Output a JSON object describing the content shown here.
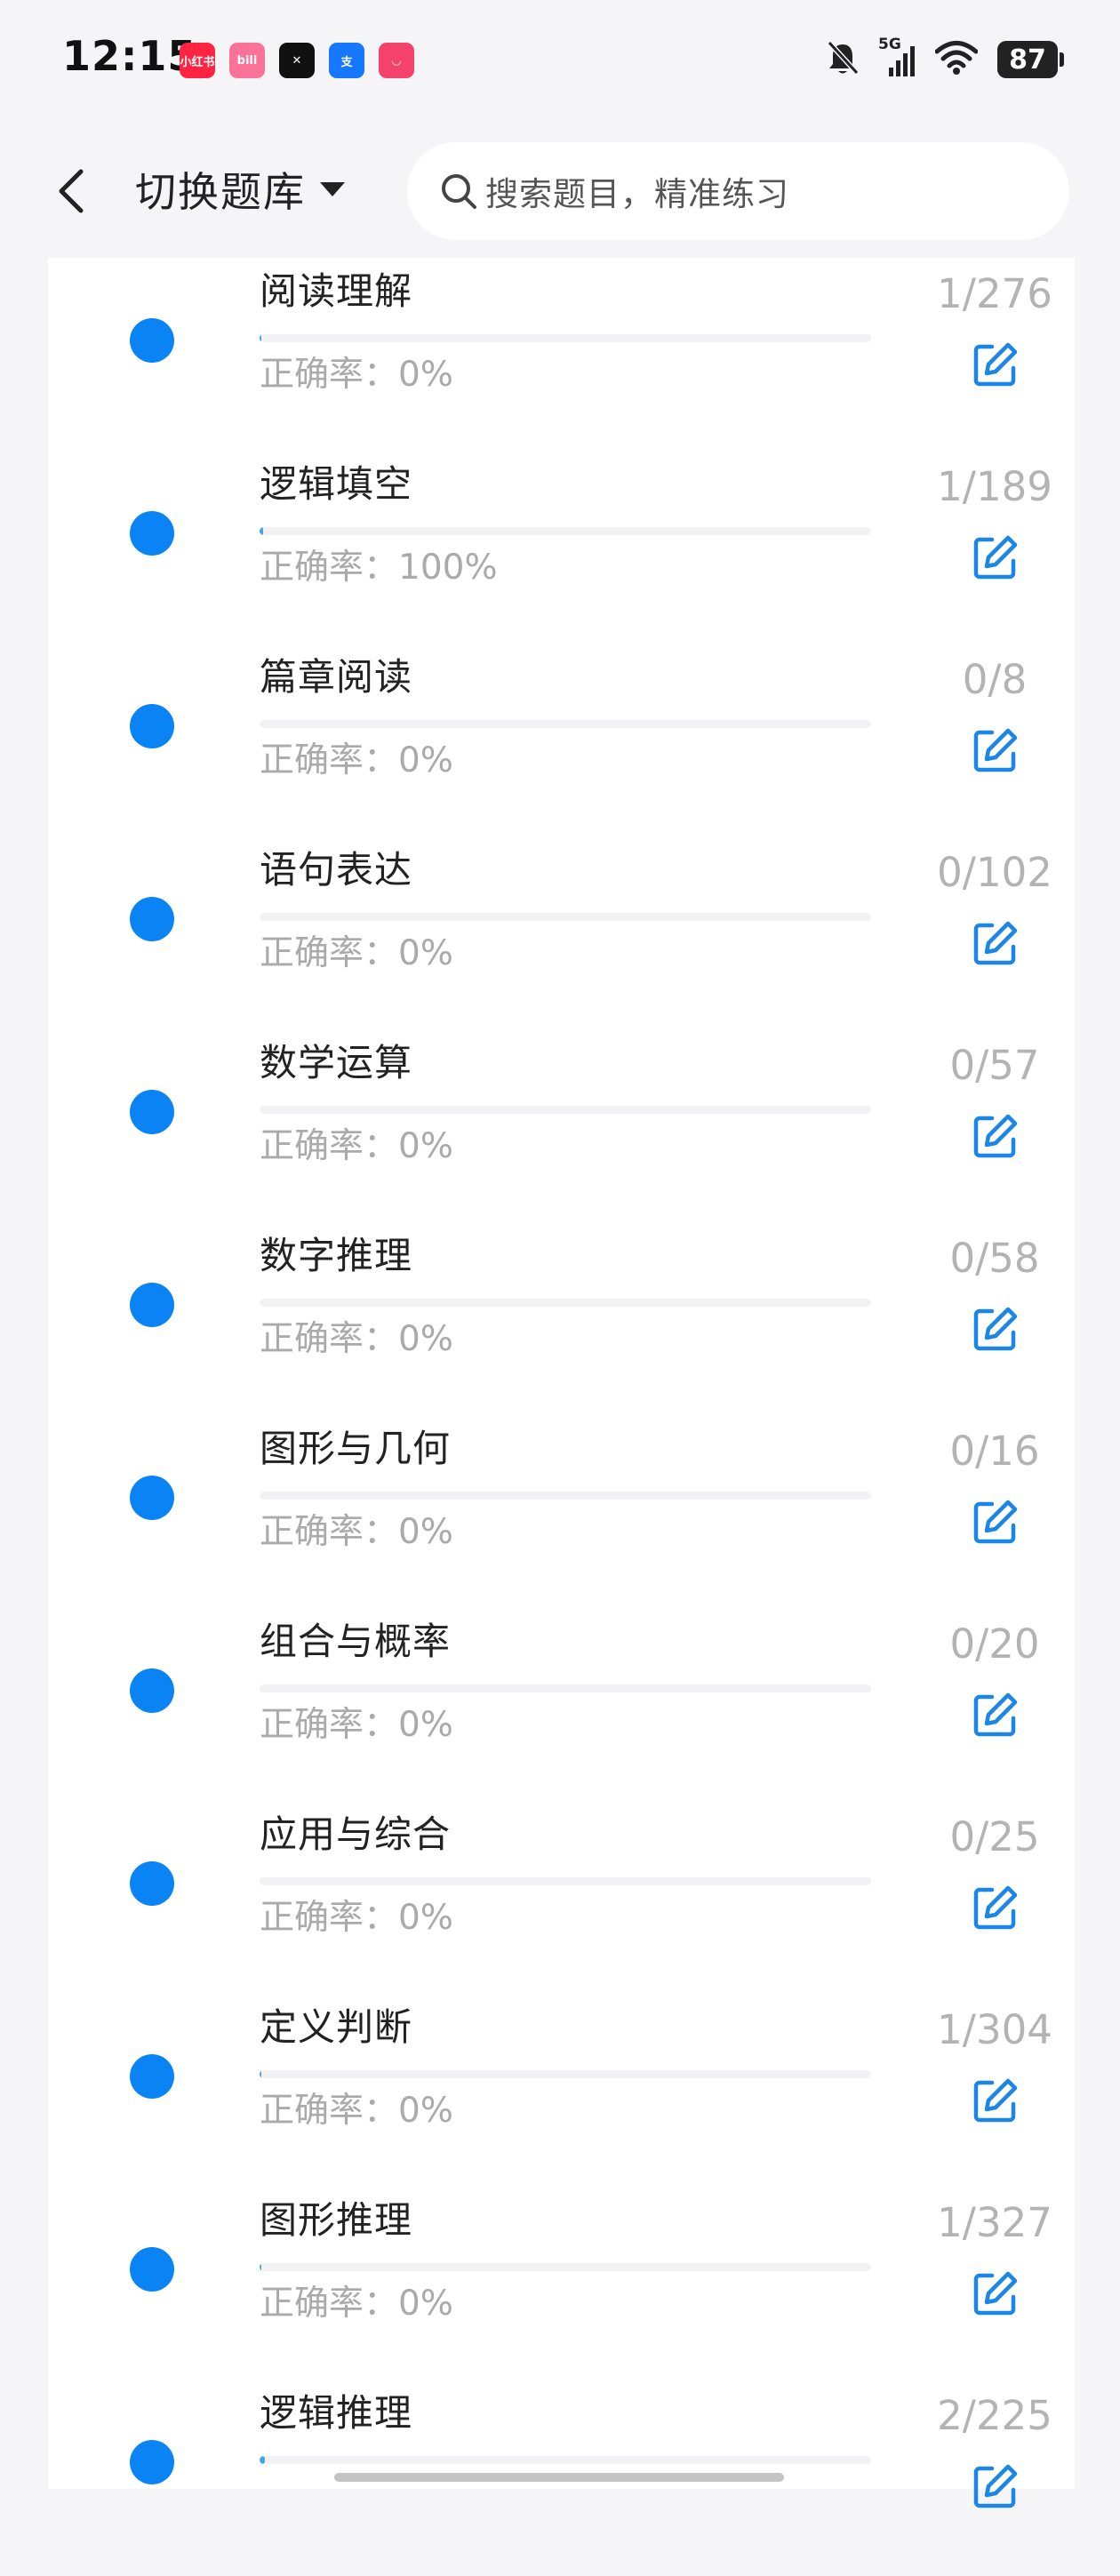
{
  "status_bar": {
    "time": "12:15",
    "app_icons": [
      {
        "name": "xiaohongshu-icon",
        "label": "小红书",
        "color": "#ff2442"
      },
      {
        "name": "bilibili-icon",
        "label": "bili",
        "color": "#fb7299"
      },
      {
        "name": "capcut-icon",
        "label": "✕",
        "color": "#111111"
      },
      {
        "name": "alipay-icon",
        "label": "支",
        "color": "#1677ff"
      },
      {
        "name": "app-pink-icon",
        "label": "◡",
        "color": "#f5426c"
      }
    ],
    "network": "5G",
    "battery": "87"
  },
  "header": {
    "switch_bank_label": "切换题库",
    "search_placeholder": "搜索题目，精准练习"
  },
  "categories": [
    {
      "title": "阅读理解",
      "count": "1/276",
      "accuracy": "正确率：0%",
      "progress": 0.0036
    },
    {
      "title": "逻辑填空",
      "count": "1/189",
      "accuracy": "正确率：100%",
      "progress": 0.0053
    },
    {
      "title": "篇章阅读",
      "count": "0/8",
      "accuracy": "正确率：0%",
      "progress": 0
    },
    {
      "title": "语句表达",
      "count": "0/102",
      "accuracy": "正确率：0%",
      "progress": 0
    },
    {
      "title": "数学运算",
      "count": "0/57",
      "accuracy": "正确率：0%",
      "progress": 0
    },
    {
      "title": "数字推理",
      "count": "0/58",
      "accuracy": "正确率：0%",
      "progress": 0
    },
    {
      "title": "图形与几何",
      "count": "0/16",
      "accuracy": "正确率：0%",
      "progress": 0
    },
    {
      "title": "组合与概率",
      "count": "0/20",
      "accuracy": "正确率：0%",
      "progress": 0
    },
    {
      "title": "应用与综合",
      "count": "0/25",
      "accuracy": "正确率：0%",
      "progress": 0
    },
    {
      "title": "定义判断",
      "count": "1/304",
      "accuracy": "正确率：0%",
      "progress": 0.0033
    },
    {
      "title": "图形推理",
      "count": "1/327",
      "accuracy": "正确率：0%",
      "progress": 0.0031
    },
    {
      "title": "逻辑推理",
      "count": "2/225",
      "accuracy": "",
      "progress": 0.0089
    }
  ],
  "colors": {
    "accent": "#0a84f5",
    "progress_fill": "#41a7e6",
    "muted_text": "#aaaaaa"
  }
}
